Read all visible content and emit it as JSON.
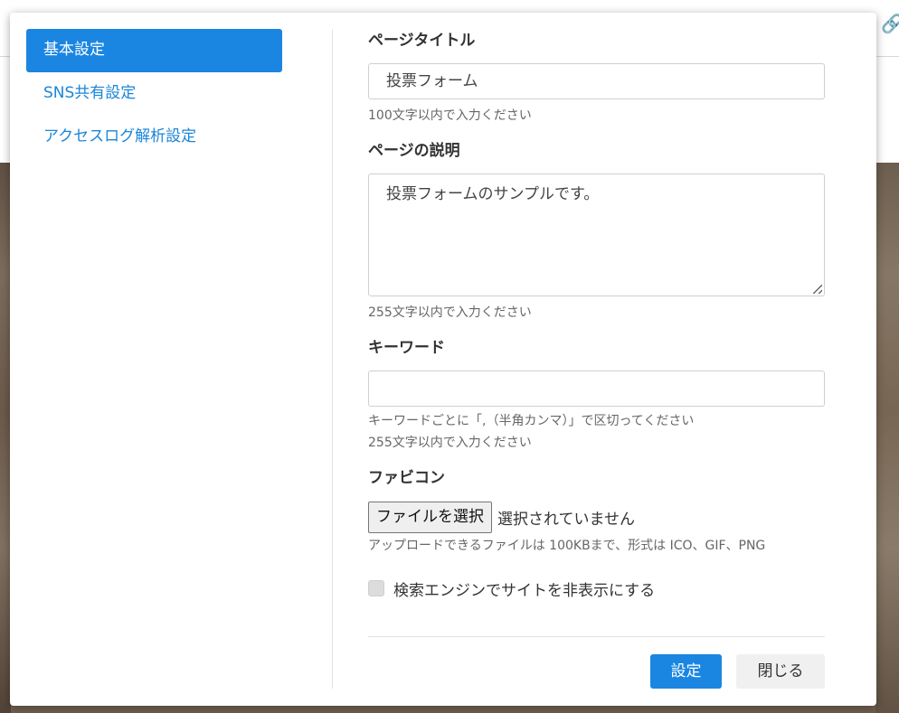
{
  "background": {
    "link_icon": "link-icon"
  },
  "sidebar": {
    "items": [
      {
        "label": "基本設定",
        "active": true
      },
      {
        "label": "SNS共有設定",
        "active": false
      },
      {
        "label": "アクセスログ解析設定",
        "active": false
      }
    ]
  },
  "form": {
    "page_title": {
      "label": "ページタイトル",
      "value": "投票フォーム",
      "help": "100文字以内で入力ください"
    },
    "page_description": {
      "label": "ページの説明",
      "value": "投票フォームのサンプルです。",
      "help": "255文字以内で入力ください"
    },
    "keywords": {
      "label": "キーワード",
      "value": "",
      "help1": "キーワードごとに「,（半角カンマ）」で区切ってください",
      "help2": "255文字以内で入力ください"
    },
    "favicon": {
      "label": "ファビコン",
      "button_label": "ファイルを選択",
      "status": "選択されていません",
      "help": "アップロードできるファイルは 100KBまで、形式は ICO、GIF、PNG"
    },
    "hide_from_search": {
      "label": "検索エンジンでサイトを非表示にする",
      "checked": false
    }
  },
  "footer": {
    "submit_label": "設定",
    "close_label": "閉じる"
  },
  "colors": {
    "accent": "#1a86e2",
    "link": "#1a86d8"
  }
}
